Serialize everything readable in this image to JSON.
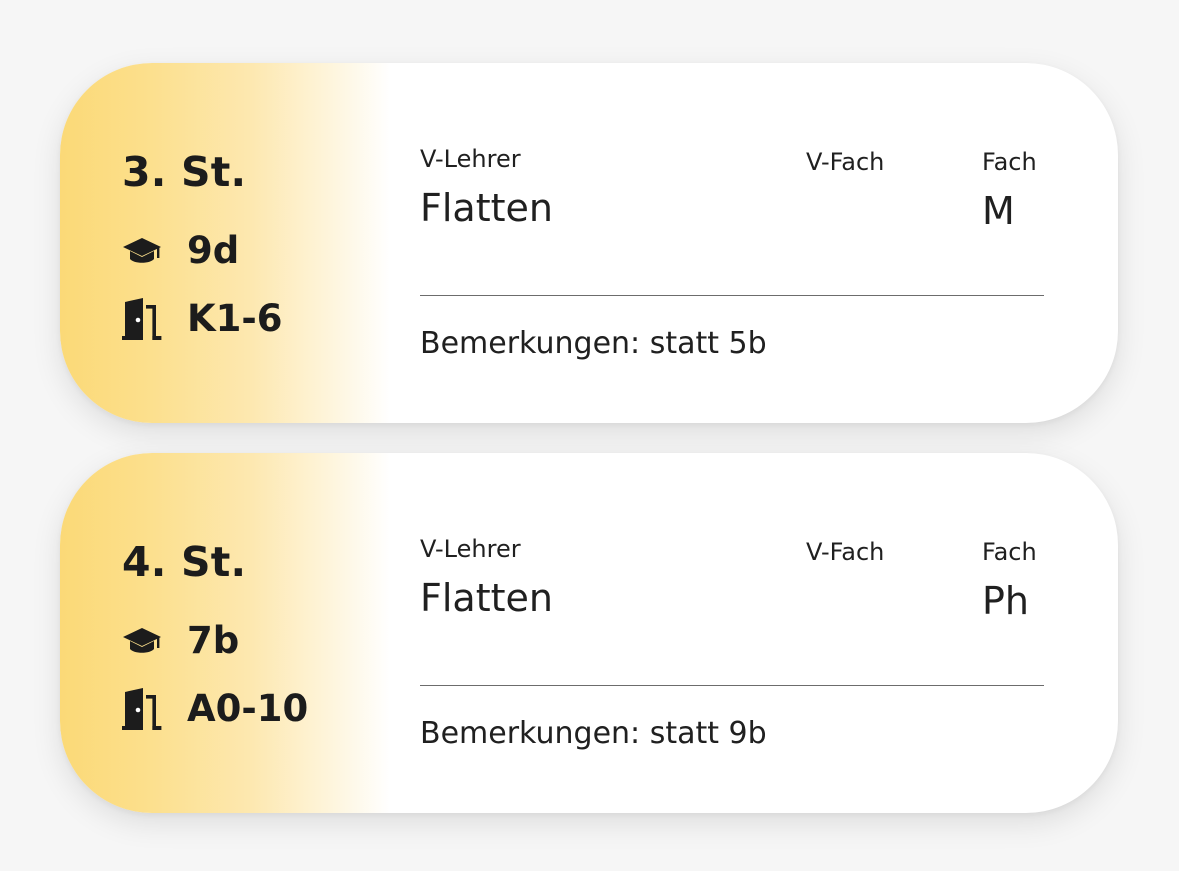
{
  "labels": {
    "teacher": "V-Lehrer",
    "substitute_subject": "V-Fach",
    "subject": "Fach"
  },
  "entries": [
    {
      "period": "3. St.",
      "class": "9d",
      "room": "K1-6",
      "teacher": "Flatten",
      "substitute_subject": "",
      "subject": "M",
      "remarks": "Bemerkungen: statt 5b"
    },
    {
      "period": "4. St.",
      "class": "7b",
      "room": "A0-10",
      "teacher": "Flatten",
      "substitute_subject": "",
      "subject": "Ph",
      "remarks": "Bemerkungen: statt 9b"
    }
  ],
  "icons": {
    "class": "graduation-cap-icon",
    "room": "door-icon"
  },
  "colors": {
    "accent": "#fbd977",
    "card": "#ffffff",
    "background": "#f6f6f6",
    "text": "#1c1c1c"
  }
}
